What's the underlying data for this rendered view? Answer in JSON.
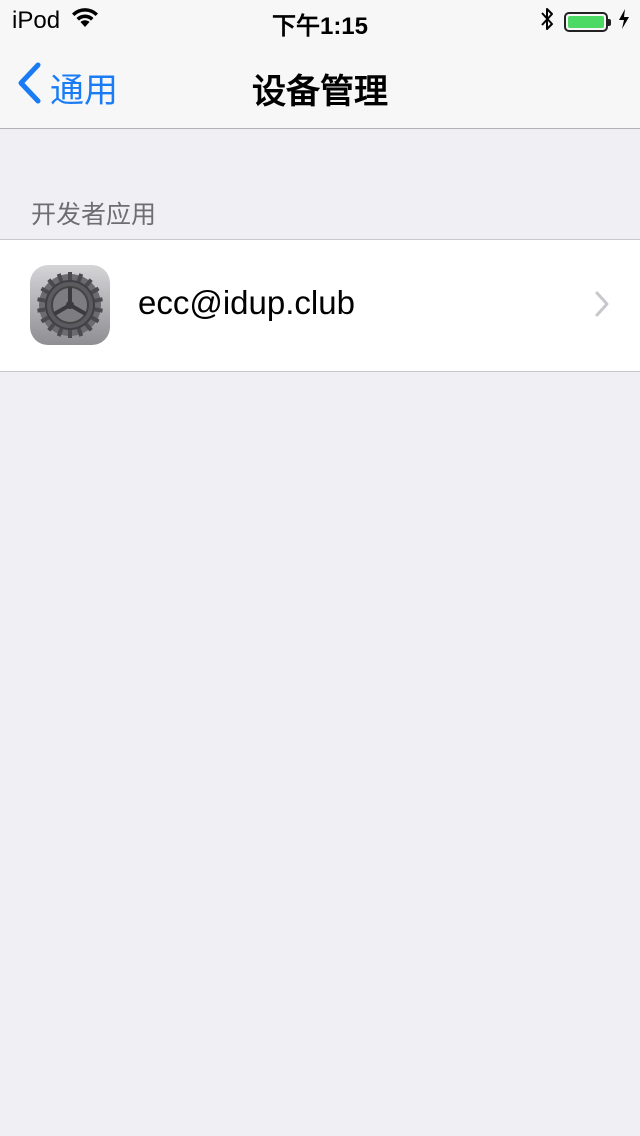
{
  "status_bar": {
    "carrier": "iPod",
    "time": "下午1:15",
    "battery_level": 1.0,
    "battery_color": "#4cd964",
    "icons": [
      "wifi-icon",
      "bluetooth-icon",
      "battery-icon",
      "charging-icon"
    ]
  },
  "nav": {
    "back_label": "通用",
    "title": "设备管理",
    "accent_color": "#1a7cf5"
  },
  "section": {
    "header": "开发者应用",
    "items": [
      {
        "label": "ecc@idup.club",
        "icon": "settings-gear-icon"
      }
    ]
  }
}
